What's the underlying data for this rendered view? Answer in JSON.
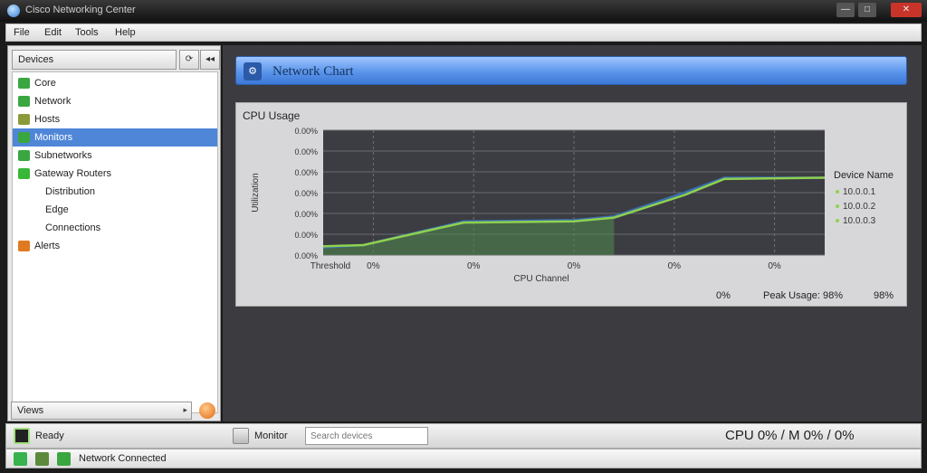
{
  "window": {
    "title": "Cisco Networking Center",
    "min_label": "—",
    "max_label": "□",
    "close_label": "✕"
  },
  "menu": {
    "items": [
      "File",
      "Edit",
      "Tools",
      "Help"
    ]
  },
  "sidebar": {
    "selector": "Devices",
    "items": [
      {
        "label": "Core",
        "indent": 1,
        "icon": "router-icon",
        "color": "#3aa640"
      },
      {
        "label": "Network",
        "indent": 1,
        "icon": "network-icon",
        "color": "#3aa640"
      },
      {
        "label": "Hosts",
        "indent": 1,
        "icon": "hosts-icon",
        "color": "#8a9a3a"
      },
      {
        "label": "Monitors",
        "indent": 1,
        "icon": "monitor-icon",
        "color": "#3aa640",
        "selected": true
      },
      {
        "label": "Subnetworks",
        "indent": 1,
        "icon": "subnet-icon",
        "color": "#3aa640"
      },
      {
        "label": "Gateway Routers",
        "indent": 1,
        "icon": "gateway-icon",
        "color": "#38b838"
      },
      {
        "label": "Distribution",
        "indent": 2,
        "icon": "",
        "color": ""
      },
      {
        "label": "Edge",
        "indent": 2,
        "icon": "",
        "color": ""
      },
      {
        "label": "Connections",
        "indent": 2,
        "icon": "",
        "color": ""
      },
      {
        "label": "Alerts",
        "indent": 1,
        "icon": "warning-icon",
        "color": "#e07a20"
      }
    ],
    "bottom_selector": "Views"
  },
  "banner": {
    "title": "Network Chart",
    "icon": "network-chart-icon"
  },
  "panel": {
    "title": "CPU Usage",
    "footer_left": "0%",
    "footer_mid": "Peak Usage: 98%",
    "footer_right": "98%"
  },
  "chart_data": {
    "type": "line",
    "title": "",
    "xlabel": "CPU Channel",
    "ylabel": "Utilization",
    "x_tick_labels": [
      "Threshold",
      "0%",
      "0%",
      "0%",
      "0%",
      "0%"
    ],
    "y_tick_labels": [
      "0.00%",
      "0.00%",
      "0.00%",
      "0.00%",
      "0.00%",
      "0.00%",
      "0.00%"
    ],
    "xlim": [
      0,
      100
    ],
    "ylim": [
      0,
      100
    ],
    "grid": true,
    "legend": {
      "title": "Device Name",
      "placement": "right",
      "entries": [
        "10.0.0.1",
        "10.0.0.2",
        "10.0.0.3"
      ]
    },
    "series": [
      {
        "name": "10.0.0.1",
        "color": "#8fd14f",
        "x": [
          0,
          8,
          28,
          50,
          58,
          72,
          80,
          100
        ],
        "y": [
          7,
          8,
          26,
          27,
          30,
          48,
          61,
          62
        ]
      },
      {
        "name": "10.0.0.2",
        "color": "#3a6fb0",
        "x": [
          0,
          8,
          28,
          50,
          58,
          72,
          80,
          100
        ],
        "y": [
          6,
          8,
          27,
          28,
          31,
          50,
          62,
          62
        ]
      }
    ],
    "fill": {
      "color": "#4f8a4f",
      "under_series": "10.0.0.1",
      "x_range": [
        0,
        58
      ]
    }
  },
  "statusbar": {
    "left_text": "Ready",
    "mid_label": "Monitor",
    "input_placeholder": "Search devices",
    "coords": "CPU 0% / M 0% / 0%"
  },
  "taskbar": {
    "text": "Network Connected"
  },
  "colors": {
    "accent": "#4f86d8",
    "chart_bg": "#3c3d42",
    "line_green": "#8fd14f"
  }
}
